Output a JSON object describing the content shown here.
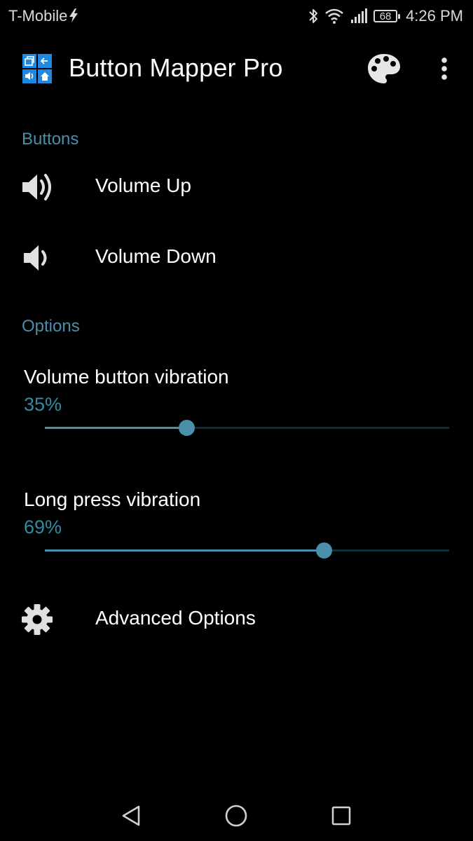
{
  "status_bar": {
    "carrier": "T-Mobile",
    "battery_level": "68",
    "time": "4:26 PM",
    "icons": [
      "lightning-bolt-icon",
      "bluetooth-icon",
      "wifi-icon",
      "signal-icon",
      "battery-icon"
    ]
  },
  "app_bar": {
    "title": "Button Mapper Pro",
    "icons": [
      "app-logo-icon",
      "palette-icon",
      "more-vert-icon"
    ]
  },
  "buttons_section": {
    "header": "Buttons",
    "items": [
      {
        "label": "Volume Up",
        "icon": "volume-up-icon"
      },
      {
        "label": "Volume Down",
        "icon": "volume-down-icon"
      }
    ]
  },
  "options_section": {
    "header": "Options",
    "sliders": [
      {
        "title": "Volume button vibration",
        "value_text": "35%",
        "fraction": 0.35
      },
      {
        "title": "Long press vibration",
        "value_text": "69%",
        "fraction": 0.69
      }
    ],
    "advanced": {
      "label": "Advanced Options",
      "icon": "gear-icon"
    }
  },
  "nav_bar": {
    "buttons": [
      "back-icon",
      "home-icon",
      "recents-icon"
    ]
  },
  "colors": {
    "accent": "#4a8fab",
    "value_text": "#2f8ca3",
    "track_inactive": "#0e2d35",
    "background": "#000000"
  }
}
